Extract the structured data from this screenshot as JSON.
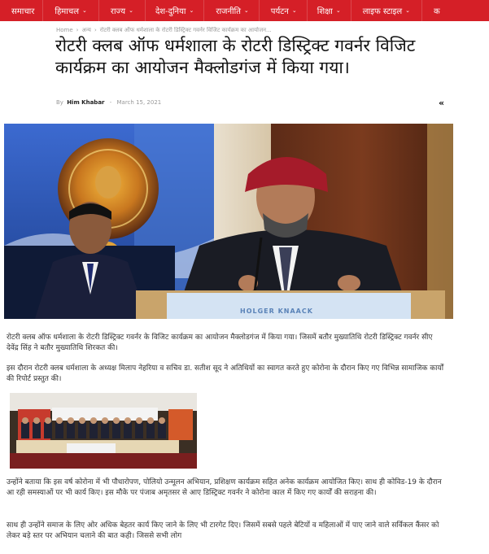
{
  "nav": {
    "items": [
      {
        "label": "समाचार",
        "chevron": false
      },
      {
        "label": "हिमाचल",
        "chevron": true
      },
      {
        "label": "राज्य",
        "chevron": true
      },
      {
        "label": "देश-दुनिया",
        "chevron": true
      },
      {
        "label": "राजनीति",
        "chevron": true
      },
      {
        "label": "पर्यटन",
        "chevron": true
      },
      {
        "label": "शिक्षा",
        "chevron": true
      },
      {
        "label": "लाइफ स्टाइल",
        "chevron": true
      },
      {
        "label": "क",
        "chevron": false
      }
    ],
    "chevron_glyph": "⌄",
    "bg_color": "#d51f27"
  },
  "breadcrumb": {
    "home": "Home",
    "category": "अन्य",
    "current": "रोटरी क्लब ऑफ धर्मशाला के रोटरी डिस्ट्रिक्ट गवर्नर विजिट कार्यक्रम का आयोजन...",
    "separator": "›"
  },
  "article": {
    "title": "रोटरी क्लब ऑफ धर्मशाला के रोटरी डिस्ट्रिक्ट गवर्नर विजिट कार्यक्रम का आयोजन मैक्लोडगंज में किया गया।",
    "by": "By",
    "author": "Him Khabar",
    "date": "March 15, 2021",
    "share_icon": "share-icon",
    "podium_text": "HOLGER KNAACK",
    "paragraphs": [
      "रोटरी क्लब ऑफ धर्मशाला के रोटरी डिस्ट्रिक्ट गवर्नर के विजिट कार्यक्रम का आयोजन मैक्लोडगंज में किया गया। जिसमें बतौर मुख्यातिथि रोटरी डिस्ट्रिक्ट गवर्नर सीए देवेंद्र सिंह ने बतौर मुख्यातिथि शिरकत की।",
      "इस दौरान रोटरी क्लब धर्मशाला के अध्यक्ष मिलाप नेहरिया व सचिव डा. सतीश सूद ने अतिथियों का स्वागत करते हुए कोरोना के दौरान किए गए विभिन्न सामाजिक कार्यों की रिपोर्ट प्रस्तुत की।",
      "उन्होंने बताया कि इस वर्ष कोरोना में भी पौधारोपण, पोलियो उन्मूलन अभियान, प्रशिक्षण कार्यक्रम सहित अनेक कार्यक्रम आयोजित किए। साथ ही कोविड-19 के दौरान आ रही समस्याओं पर भी कार्य किए। इस मौके पर पंजाब अमृतसर से आए डिस्ट्रिक्ट गवर्नर ने कोरोना काल में किए गए कार्यों की सराहना की।",
      "साथ ही उन्होंने समाज के लिए ओर अधिक बेहतर कार्य किए जाने के लिए भी टारगेट दिए। जिसमें सबसे पहले बेटियों व महिलाओं में पाए जाने वाले सर्विकल कैंसर को लेकर बड़े स्तर पर अभियान चलाने की बात कही। जिससे सभी लोग"
    ]
  }
}
